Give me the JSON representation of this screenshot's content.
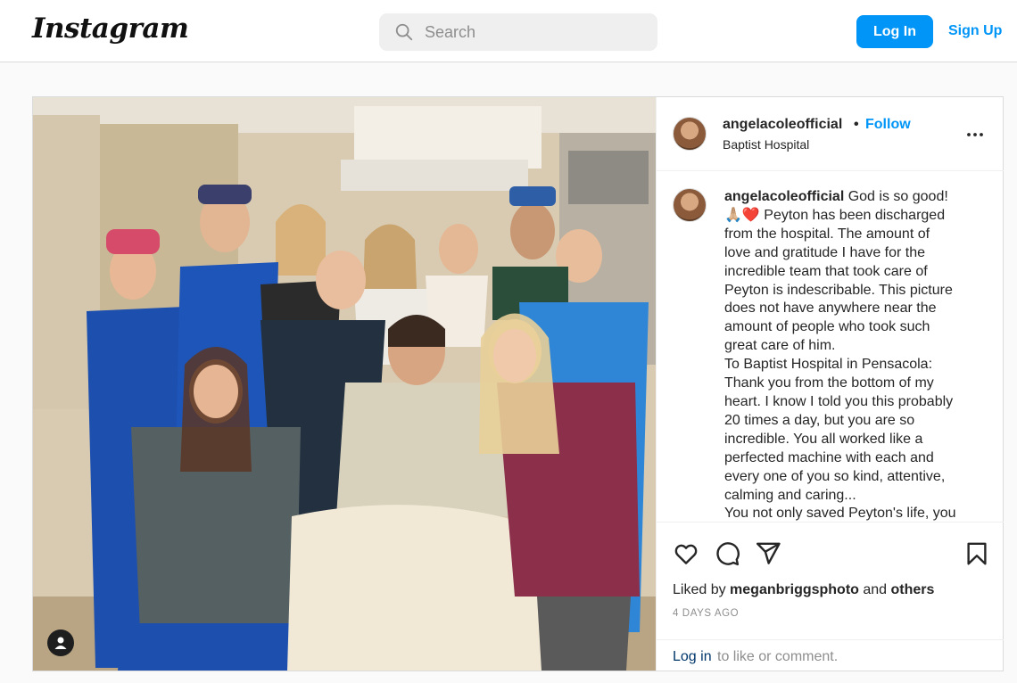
{
  "header": {
    "logo_text": "Instagram",
    "search_placeholder": "Search",
    "login_label": "Log In",
    "signup_label": "Sign Up"
  },
  "post": {
    "username": "angelacoleofficial",
    "separator": "•",
    "follow_label": "Follow",
    "location": "Baptist Hospital",
    "caption_lines": [
      {
        "user": "angelacoleofficial",
        "text": " God is so good!"
      },
      {
        "text": "🙏🏼❤️ Peyton has been discharged"
      },
      {
        "text": "from the hospital. The amount of"
      },
      {
        "text": "love and gratitude I have for the"
      },
      {
        "text": "incredible team that took care of"
      },
      {
        "text": "Peyton is indescribable. This picture"
      },
      {
        "text": "does not have anywhere near the"
      },
      {
        "text": "amount of people who took such"
      },
      {
        "text": "great care of him."
      },
      {
        "text": "To Baptist Hospital in Pensacola:"
      },
      {
        "text": "Thank you from the bottom of my"
      },
      {
        "text": "heart. I know I told you this probably"
      },
      {
        "text": "20 times a day, but you are so"
      },
      {
        "text": "incredible. You all worked like a"
      },
      {
        "text": "perfected machine with each and"
      },
      {
        "text": "every one of you so kind, attentive,"
      },
      {
        "text": "calming and caring..."
      },
      {
        "text": "You not only saved Peyton's life, you"
      }
    ],
    "liked_by_prefix": "Liked by ",
    "liked_by_user": "meganbriggsphoto",
    "liked_by_and": " and ",
    "liked_by_others": "others",
    "timestamp": "4 DAYS AGO",
    "comment_login": "Log in",
    "comment_rest": " to like or comment."
  },
  "colors": {
    "accent": "#0095f6",
    "text": "#262626",
    "muted": "#8e8e8e",
    "border": "#dbdbdb"
  },
  "icons": [
    "search-icon",
    "more-options-icon",
    "heart-icon",
    "comment-icon",
    "share-icon",
    "save-icon",
    "user-tag-icon"
  ]
}
